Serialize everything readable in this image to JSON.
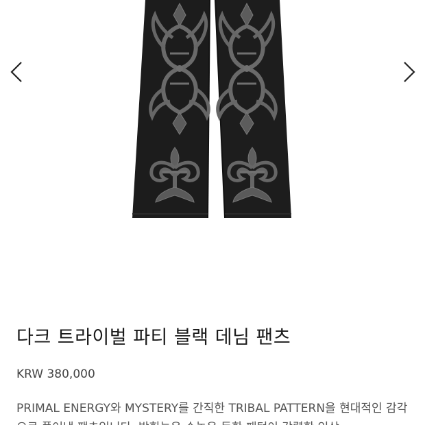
{
  "gallery": {
    "prev_icon": "chevron-left-icon",
    "next_icon": "chevron-right-icon",
    "image_alt": ""
  },
  "product": {
    "title": "다크 트라이벌 파티 블랙 데님 팬츠",
    "currency": "KRW",
    "price": "380,000",
    "price_display": "KRW 380,000",
    "description": "PRIMAL ENERGY와 MYSTERY를 간직한 TRIBAL PATTERN을 현대적인 감각으로 풀어낸 팬츠입니다. 박힌늘은 수놓은 듯한 패턴이 강렬한 인상"
  },
  "colors": {
    "background": "#ffffff",
    "denim": "#1c1c1c",
    "embroidery": "#555555"
  }
}
